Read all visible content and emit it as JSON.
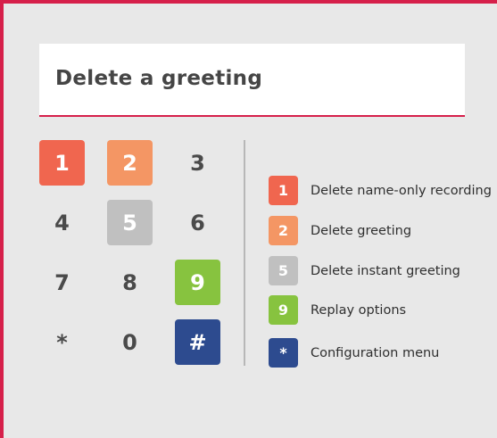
{
  "title": "Delete a greeting",
  "colors": {
    "frame_border": "#d61f4a",
    "background": "#e8e8e8",
    "key_red": "#f0664f",
    "key_orange": "#f49664",
    "key_gray": "#c0c0c0",
    "key_green": "#87c33f",
    "key_navy": "#2d4b8f"
  },
  "keypad": {
    "keys": [
      {
        "label": "1",
        "color": "#f0664f"
      },
      {
        "label": "2",
        "color": "#f49664"
      },
      {
        "label": "3",
        "color": null
      },
      {
        "label": "4",
        "color": null
      },
      {
        "label": "5",
        "color": "#c0c0c0"
      },
      {
        "label": "6",
        "color": null
      },
      {
        "label": "7",
        "color": null
      },
      {
        "label": "8",
        "color": null
      },
      {
        "label": "9",
        "color": "#87c33f"
      },
      {
        "label": "*",
        "color": null
      },
      {
        "label": "0",
        "color": null
      },
      {
        "label": "#",
        "color": "#2d4b8f"
      }
    ]
  },
  "legend": {
    "items": [
      {
        "key": "1",
        "label": "Delete name-only recording",
        "color": "#f0664f"
      },
      {
        "key": "2",
        "label": "Delete greeting",
        "color": "#f49664"
      },
      {
        "key": "5",
        "label": "Delete instant greeting",
        "color": "#c0c0c0"
      },
      {
        "key": "9",
        "label": "Replay options",
        "color": "#87c33f"
      },
      {
        "key": "*",
        "label": "Configuration menu",
        "color": "#2d4b8f"
      }
    ]
  }
}
